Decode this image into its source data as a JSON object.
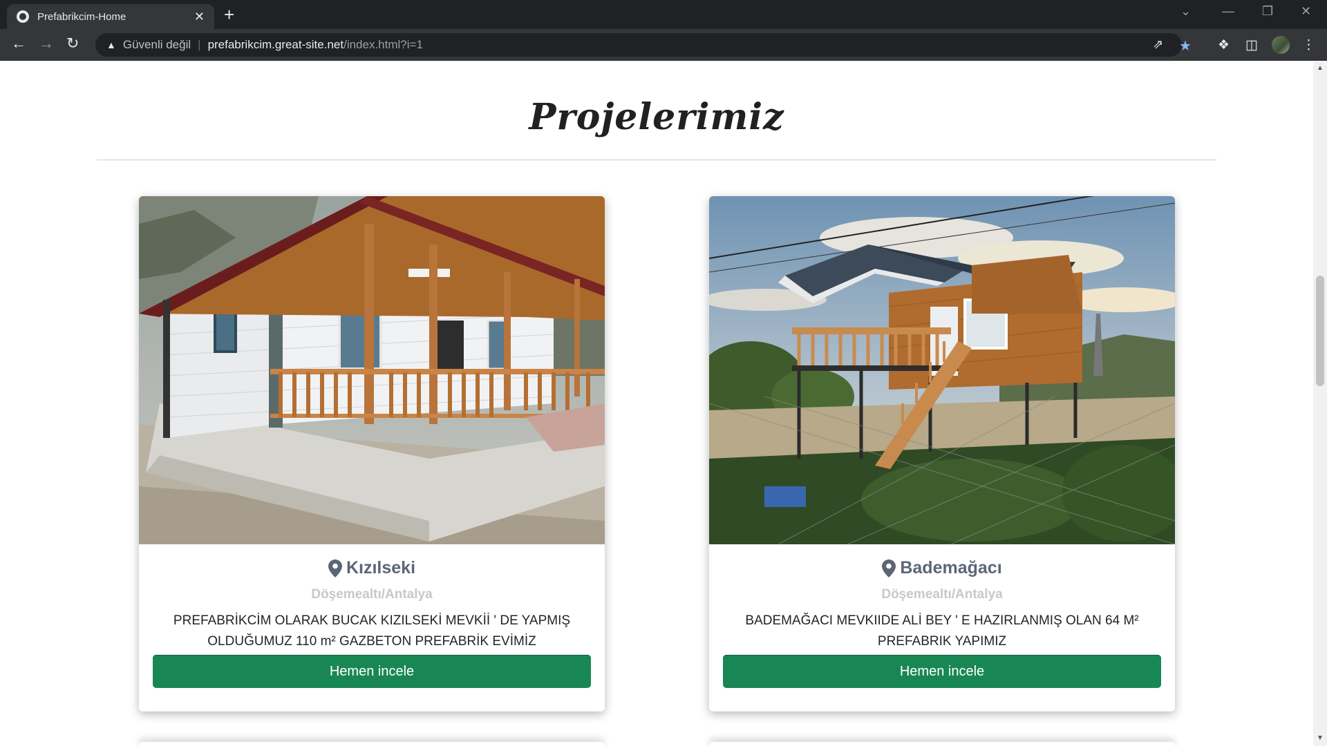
{
  "browser": {
    "tab_title": "Prefabrikcim-Home",
    "tab_close": "✕",
    "new_tab": "+",
    "back_icon": "arrow-left-icon",
    "forward_icon": "arrow-right-icon",
    "reload_icon": "reload-icon",
    "security_text": "Güvenli değil",
    "separator": "|",
    "url_host": "prefabrikcim.great-site.net",
    "url_path": "/index.html?i=1"
  },
  "page": {
    "section_title": "Projelerimiz"
  },
  "projects": [
    {
      "title": "Kızılseki",
      "subtitle": "Döşemealtı/Antalya",
      "description_line1": "PREFABRİKCİM OLARAK BUCAK KIZILSEKİ MEVKİİ ' DE YAPMIŞ",
      "description_line2": "OLDUĞUMUZ 110 m² GAZBETON PREFABRİK EVİMİZ",
      "button_label": "Hemen incele"
    },
    {
      "title": "Bademağacı",
      "subtitle": "Döşemealtı/Antalya",
      "description_line1": "BADEMAĞACI MEVKIIDE ALİ BEY ' E HAZIRLANMIŞ OLAN 64 M²",
      "description_line2": "PREFABRIK YAPIMIZ",
      "button_label": "Hemen incele"
    }
  ],
  "colors": {
    "button_green": "#198754",
    "title_gray": "#5b6675",
    "subtitle_gray": "#c8c8c8",
    "chrome_dark": "#202124",
    "bookmark_star": "#8ab4f8"
  }
}
